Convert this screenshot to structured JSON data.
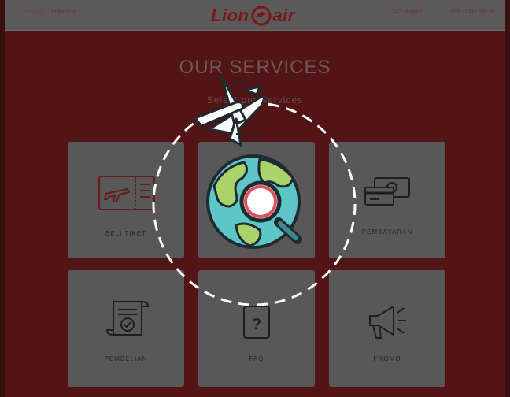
{
  "header": {
    "lang_label": "Bahasa",
    "lang_value": "Indonesia",
    "logo_text": "Lion",
    "logo_text_2": "air",
    "support_label": "24/7 Support",
    "phone": "021 - 2211 092 91"
  },
  "section": {
    "title": "OUR SERVICES",
    "subtitle": "Select our Services"
  },
  "services": [
    {
      "label": "BELI TIKET",
      "icon": "ticket-icon"
    },
    {
      "label": "",
      "icon": "search-icon"
    },
    {
      "label": "PEMBAYARAN",
      "icon": "payment-icon"
    },
    {
      "label": "PEMBELIAN",
      "icon": "document-check-icon"
    },
    {
      "label": "FAQ",
      "icon": "faq-icon"
    },
    {
      "label": "PROMO",
      "icon": "megaphone-icon"
    }
  ],
  "colors": {
    "background": "#521414",
    "card": "#585858",
    "brand_red": "#7a1616"
  }
}
